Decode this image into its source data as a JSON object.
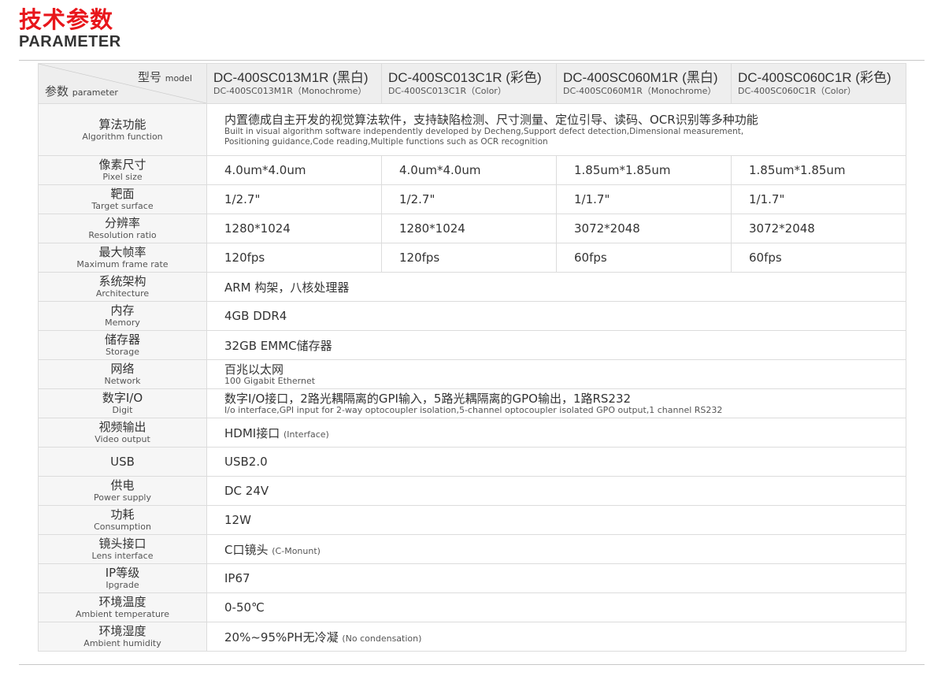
{
  "header": {
    "title_cn": "技术参数",
    "title_en": "PARAMETER"
  },
  "table_head": {
    "model_cn": "型号",
    "model_en": "model",
    "param_cn": "参数",
    "param_en": "parameter",
    "models": [
      {
        "name": "DC-400SC013M1R (黑白)",
        "sub": "DC-400SC013M1R（Monochrome）"
      },
      {
        "name": "DC-400SC013C1R (彩色)",
        "sub": "DC-400SC013C1R（Color）"
      },
      {
        "name": "DC-400SC060M1R (黑白)",
        "sub": "DC-400SC060M1R（Monochrome）"
      },
      {
        "name": "DC-400SC060C1R (彩色)",
        "sub": "DC-400SC060C1R（Color）"
      }
    ]
  },
  "rows": [
    {
      "cn": "算法功能",
      "en": "Algorithm function",
      "value": "内置德成自主开发的视觉算法软件，支持缺陷检测、尺寸测量、定位引导、读码、OCR识别等多种功能",
      "sub1": "Built in visual algorithm software independently developed by Decheng,Support defect detection,Dimensional measurement,",
      "sub2": "Positioning guidance,Code reading,Multiple functions such as OCR recognition"
    },
    {
      "cn": "像素尺寸",
      "en": "Pixel size",
      "values": [
        "4.0um*4.0um",
        "4.0um*4.0um",
        "1.85um*1.85um",
        "1.85um*1.85um"
      ]
    },
    {
      "cn": "靶面",
      "en": "Target surface",
      "values": [
        "1/2.7\"",
        "1/2.7\"",
        "1/1.7\"",
        "1/1.7\""
      ]
    },
    {
      "cn": "分辨率",
      "en": "Resolution ratio",
      "values": [
        "1280*1024",
        "1280*1024",
        "3072*2048",
        "3072*2048"
      ]
    },
    {
      "cn": "最大帧率",
      "en": "Maximum frame rate",
      "values": [
        "120fps",
        "120fps",
        "60fps",
        "60fps"
      ]
    },
    {
      "cn": "系统架构",
      "en": "Architecture",
      "value": "ARM 构架，八核处理器"
    },
    {
      "cn": "内存",
      "en": "Memory",
      "value": "4GB DDR4"
    },
    {
      "cn": "储存器",
      "en": "Storage",
      "value": "32GB  EMMC储存器"
    },
    {
      "cn": "网络",
      "en": "Network",
      "value": "百兆以太网",
      "sub": "100 Gigabit Ethernet"
    },
    {
      "cn": "数字I/O",
      "en": "Digit",
      "value": "数字I/O接口，2路光耦隔离的GPI输入，5路光耦隔离的GPO输出，1路RS232",
      "sub": "I/o interface,GPI input for 2-way optocoupler isolation,5-channel optocoupler isolated GPO output,1 channel RS232"
    },
    {
      "cn": "视频输出",
      "en": "Video output",
      "value": "HDMI接口",
      "note": "(Interface)"
    },
    {
      "cn": "USB",
      "en": "",
      "value": "USB2.0"
    },
    {
      "cn": "供电",
      "en": "Power supply",
      "value": "DC 24V"
    },
    {
      "cn": "功耗",
      "en": "Consumption",
      "value": "12W"
    },
    {
      "cn": "镜头接口",
      "en": "Lens interface",
      "value": "C口镜头",
      "note": "(C-Monunt)"
    },
    {
      "cn": "IP等级",
      "en": "Ipgrade",
      "value": "IP67"
    },
    {
      "cn": "环境温度",
      "en": "Ambient temperature",
      "value": "0-50℃"
    },
    {
      "cn": "环境湿度",
      "en": "Ambient humidity",
      "value": "20%~95%PH无冷凝",
      "note": "(No condensation)"
    }
  ]
}
